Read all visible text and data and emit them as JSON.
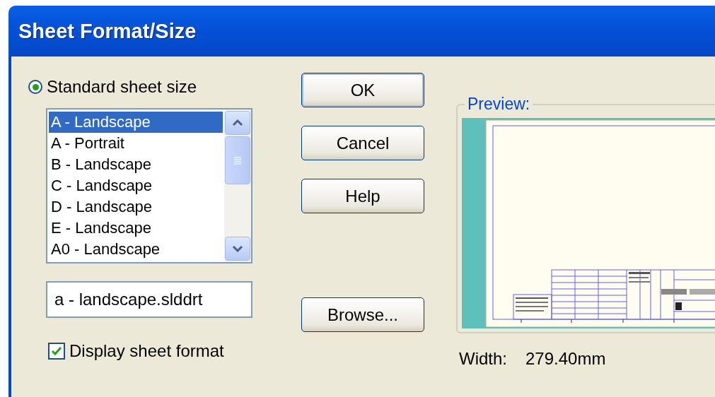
{
  "window": {
    "title": "Sheet Format/Size"
  },
  "standard_size": {
    "label": "Standard sheet size",
    "selected": true
  },
  "sizes": [
    {
      "label": "A - Landscape",
      "selected": true
    },
    {
      "label": "A - Portrait",
      "selected": false
    },
    {
      "label": "B - Landscape",
      "selected": false
    },
    {
      "label": "C - Landscape",
      "selected": false
    },
    {
      "label": "D - Landscape",
      "selected": false
    },
    {
      "label": "E - Landscape",
      "selected": false
    },
    {
      "label": "A0 - Landscape",
      "selected": false
    }
  ],
  "format_file": {
    "value": "a - landscape.slddrt"
  },
  "display_sheet_format": {
    "label": "Display sheet format",
    "checked": true
  },
  "buttons": [
    {
      "label": "OK",
      "default": true
    },
    {
      "label": "Cancel",
      "default": false
    },
    {
      "label": "Help",
      "default": false
    }
  ],
  "browse_button": {
    "label": "Browse..."
  },
  "preview": {
    "title": "Preview:"
  },
  "width": {
    "label": "Width:",
    "value": "279.40mm"
  }
}
